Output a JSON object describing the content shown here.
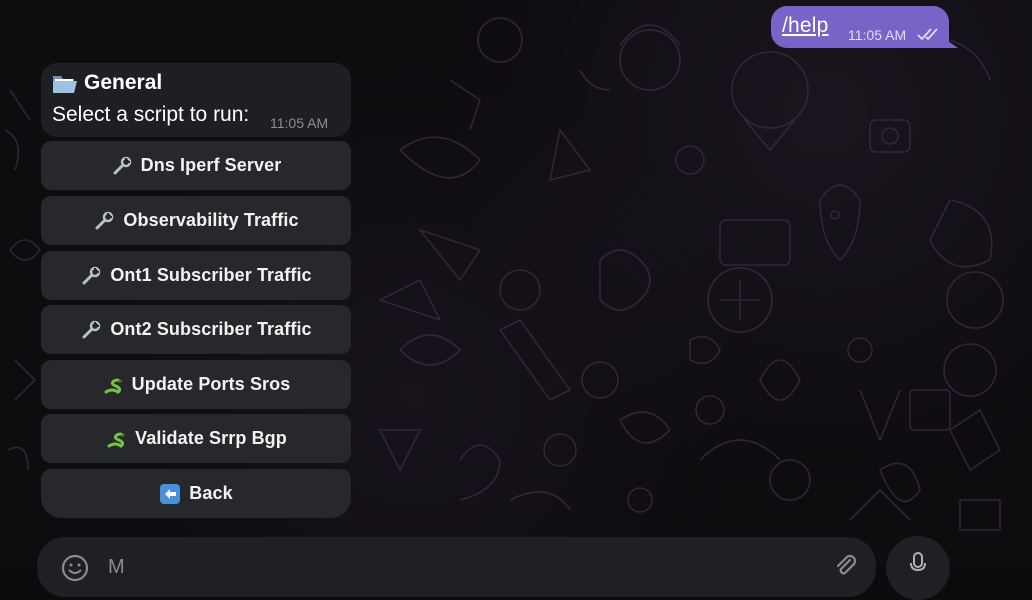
{
  "outgoing": {
    "text": "/help",
    "time": "11:05 AM",
    "read_icon": "double-check-icon"
  },
  "incoming": {
    "title_icon": "open-folder-icon",
    "title": "General",
    "text": "Select a script to run:",
    "time": "11:05 AM"
  },
  "keyboard": [
    {
      "icon": "wrench-icon",
      "label": "Dns Iperf Server"
    },
    {
      "icon": "wrench-icon",
      "label": "Observability Traffic"
    },
    {
      "icon": "wrench-icon",
      "label": "Ont1 Subscriber Traffic"
    },
    {
      "icon": "wrench-icon",
      "label": "Ont2 Subscriber Traffic"
    },
    {
      "icon": "snake-icon",
      "label": "Update Ports Sros"
    },
    {
      "icon": "snake-icon",
      "label": "Validate Srrp Bgp"
    },
    {
      "icon": "back-arrow-icon",
      "label": "Back"
    }
  ],
  "composer": {
    "placeholder": "M",
    "emoji_icon": "emoji-icon",
    "attach_icon": "paperclip-icon",
    "mic_icon": "microphone-icon"
  },
  "colors": {
    "outgoing_bubble": "#7a63c6",
    "incoming_bubble": "#1e1f22",
    "keyboard_button": "#26282c",
    "background": "#0d0c0f"
  }
}
